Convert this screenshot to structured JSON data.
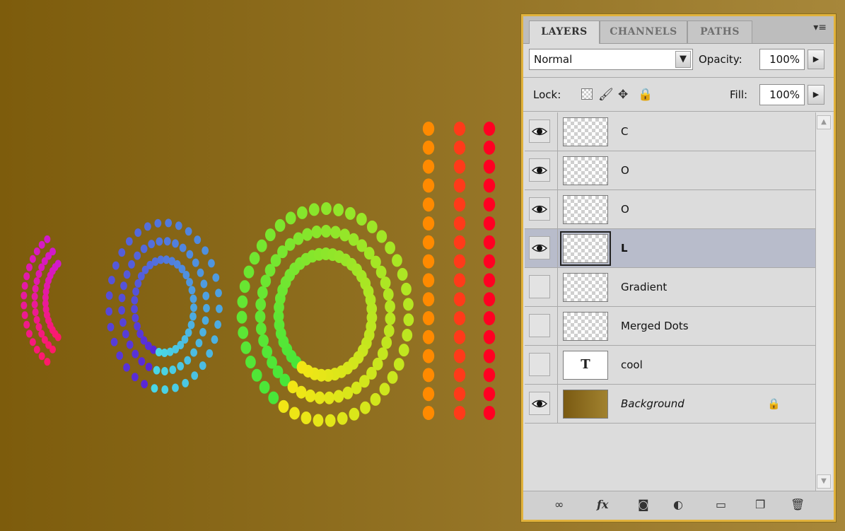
{
  "canvas": {
    "background_start": "#7d5c0c",
    "background_end": "#a7873a",
    "letter_colors": [
      "#ff1a6a",
      "#d21acb",
      "#5a22d6",
      "#49d7e4",
      "#44e63a",
      "#f2e615",
      "#ff8a00",
      "#ff3a1a",
      "#ff0022"
    ]
  },
  "panel": {
    "tabs": [
      {
        "label": "LAYERS",
        "active": true
      },
      {
        "label": "CHANNELS",
        "active": false
      },
      {
        "label": "PATHS",
        "active": false
      }
    ],
    "menu_icon": "panel-menu-icon",
    "blend_mode": "Normal",
    "opacity_label": "Opacity:",
    "opacity_value": "100%",
    "lock_label": "Lock:",
    "lock_icons": [
      "lock-transparent-icon",
      "lock-image-icon",
      "lock-position-icon",
      "lock-all-icon"
    ],
    "fill_label": "Fill:",
    "fill_value": "100%",
    "layers": [
      {
        "name": "C",
        "visible": true,
        "selected": false,
        "thumb": "transparent"
      },
      {
        "name": "O",
        "visible": true,
        "selected": false,
        "thumb": "transparent"
      },
      {
        "name": "O",
        "visible": true,
        "selected": false,
        "thumb": "transparent"
      },
      {
        "name": "L",
        "visible": true,
        "selected": true,
        "thumb": "transparent"
      },
      {
        "name": "Gradient",
        "visible": false,
        "selected": false,
        "thumb": "transparent"
      },
      {
        "name": "Merged Dots",
        "visible": false,
        "selected": false,
        "thumb": "transparent"
      },
      {
        "name": "cool",
        "visible": false,
        "selected": false,
        "thumb": "text",
        "thumb_text": "T"
      },
      {
        "name": "Background",
        "visible": true,
        "selected": false,
        "thumb": "background",
        "locked": true
      }
    ],
    "footer_icons": [
      "link-layers-icon",
      "fx-icon",
      "layer-mask-icon",
      "adjustment-layer-icon",
      "new-group-icon",
      "new-layer-icon",
      "trash-icon"
    ],
    "footer_fx_text": "fx",
    "accent": "#e1b23c",
    "selection_color": "#b8bccb"
  }
}
